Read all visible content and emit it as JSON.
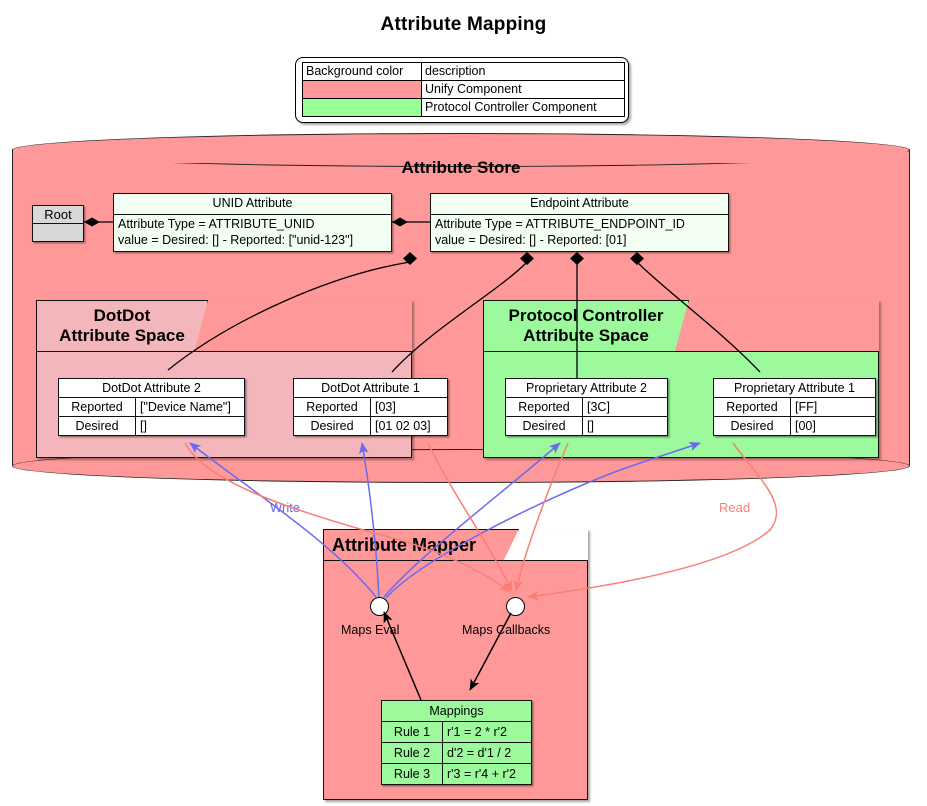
{
  "title": "Attribute Mapping",
  "colors": {
    "unify_component": "#FF9999",
    "protocol_controller_component": "#99FF99",
    "dotdot_space": "#F2B6BB",
    "write_arrow": "#6a6aef",
    "read_arrow": "#f97f76",
    "attribute_box": "#F2FFF2"
  },
  "legend": {
    "header": {
      "color_col": "Background color",
      "desc_col": "description"
    },
    "rows": [
      {
        "swatch": "#FF9999",
        "description": "Unify Component"
      },
      {
        "swatch": "#99FF99",
        "description": "Protocol Controller Component"
      }
    ]
  },
  "attribute_store": {
    "title": "Attribute Store",
    "root": {
      "label": "Root"
    },
    "unid_attribute": {
      "title": "UNID Attribute",
      "lines": [
        "Attribute Type = ATTRIBUTE_UNID",
        "value = Desired: [] - Reported: [\"unid-123\"]"
      ]
    },
    "endpoint_attribute": {
      "title": "Endpoint Attribute",
      "lines": [
        "Attribute Type = ATTRIBUTE_ENDPOINT_ID",
        "value = Desired: [] - Reported: [01]"
      ]
    },
    "dotdot_space": {
      "title_line1": "DotDot",
      "title_line2": "Attribute Space",
      "attributes": [
        {
          "title": "DotDot Attribute 2",
          "rows": [
            {
              "key": "Reported",
              "value": "[\"Device Name\"]"
            },
            {
              "key": "Desired",
              "value": "[]"
            }
          ]
        },
        {
          "title": "DotDot Attribute 1",
          "rows": [
            {
              "key": "Reported",
              "value": "[03]"
            },
            {
              "key": "Desired",
              "value": "[01 02 03]"
            }
          ]
        }
      ]
    },
    "protocol_controller_space": {
      "title_line1": "Protocol Controller",
      "title_line2": "Attribute Space",
      "attributes": [
        {
          "title": "Proprietary Attribute 2",
          "rows": [
            {
              "key": "Reported",
              "value": "[3C]"
            },
            {
              "key": "Desired",
              "value": "[]"
            }
          ]
        },
        {
          "title": "Proprietary Attribute 1",
          "rows": [
            {
              "key": "Reported",
              "value": "[FF]"
            },
            {
              "key": "Desired",
              "value": "[00]"
            }
          ]
        }
      ]
    }
  },
  "attribute_mapper": {
    "title": "Attribute Mapper",
    "ports": [
      {
        "label": "Maps Eval"
      },
      {
        "label": "Maps Callbacks"
      }
    ],
    "mappings": {
      "title": "Mappings",
      "rules": [
        {
          "name": "Rule 1",
          "expression": "r'1 =  2 * r'2"
        },
        {
          "name": "Rule 2",
          "expression": "d'2 =  d'1 / 2"
        },
        {
          "name": "Rule 3",
          "expression": "r'3 =  r'4 + r'2"
        }
      ]
    }
  },
  "edge_labels": {
    "write": "Write",
    "read": "Read"
  }
}
